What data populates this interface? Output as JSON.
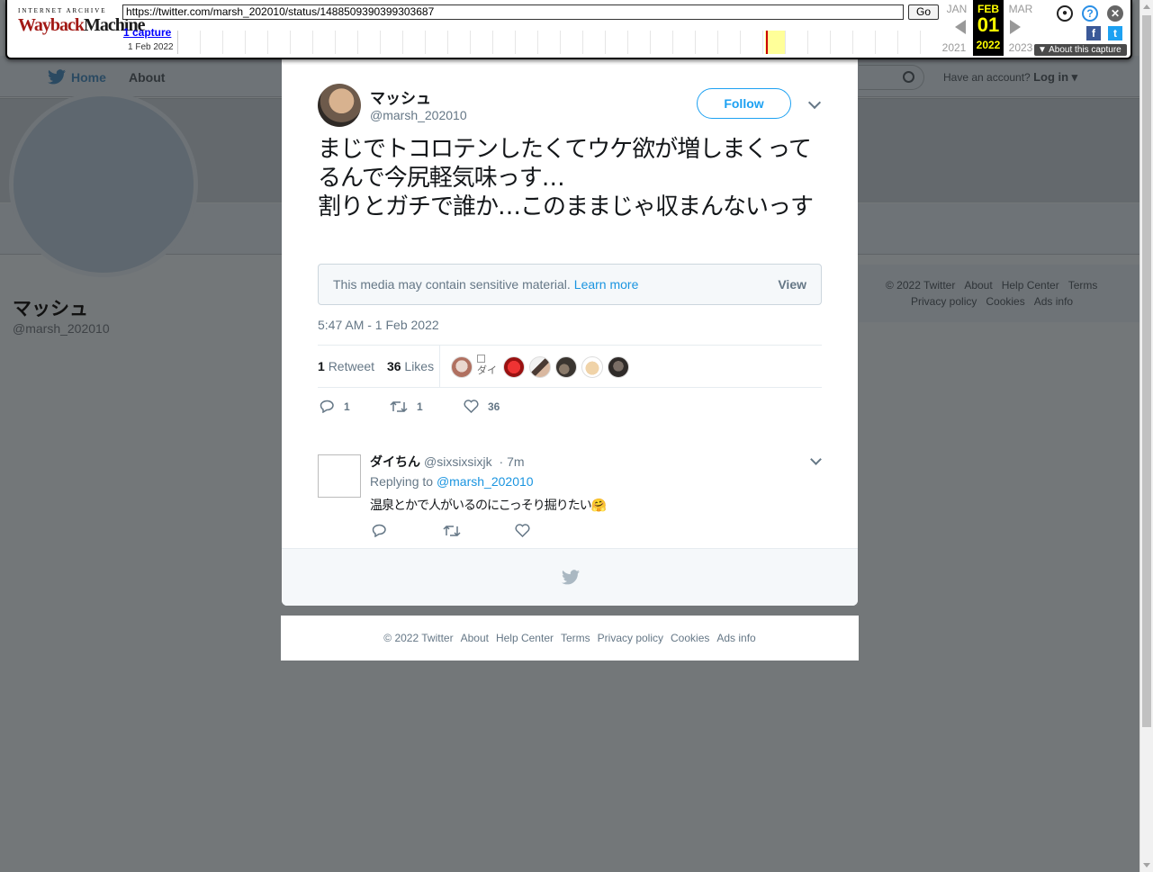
{
  "wayback": {
    "logo_top": "INTERNET ARCHIVE",
    "logo_main_1": "Wayback",
    "logo_main_2": "Machine",
    "url": "https://twitter.com/marsh_202010/status/1488509390399303687",
    "go_label": "Go",
    "captures_label": "1 capture",
    "capture_date": "1 Feb 2022",
    "prev_month": "JAN",
    "prev_year": "2021",
    "cur_month": "FEB",
    "cur_day": "01",
    "cur_year": "2022",
    "next_month": "MAR",
    "next_year": "2023",
    "about_capture": "▼ About this capture"
  },
  "nav": {
    "home_label": "Home",
    "about_label": "About",
    "account_text": "Have an account?",
    "login_label": "Log in ▾"
  },
  "profile": {
    "name": "マッシュ",
    "handle": "@marsh_202010"
  },
  "side_footer": [
    "© 2022 Twitter",
    "About",
    "Help Center",
    "Terms",
    "Privacy policy",
    "Cookies",
    "Ads info"
  ],
  "tweet": {
    "author_name": "マッシュ",
    "author_handle": "@marsh_202010",
    "follow_label": "Follow",
    "text": "まじでトコロテンしたくてウケ欲が増しまくってるんで今尻軽気味っす…\n割りとガチで誰か…このままじゃ収まんないっす",
    "sensitive_text": "This media may contain sensitive material.",
    "learn_more": "Learn more",
    "view_label": "View",
    "timestamp": "5:47 AM - 1 Feb 2022",
    "retweet_count": "1",
    "retweet_label": "Retweet",
    "like_count": "36",
    "like_label": "Likes",
    "broken_avatar_alt": "ダイ",
    "reply_action_count": "1",
    "retweet_action_count": "1",
    "like_action_count": "36"
  },
  "reply": {
    "name": "ダイちん",
    "handle": "@sixsixsixjk",
    "time": "· 7m",
    "replying_to": "Replying to",
    "replying_handle": "@marsh_202010",
    "text": "温泉とかで人がいるのにこっそり掘りたい🤗"
  },
  "footer": [
    "© 2022 Twitter",
    "About",
    "Help Center",
    "Terms",
    "Privacy policy",
    "Cookies",
    "Ads info"
  ],
  "colors": {
    "twitter_blue": "#1da1f2",
    "link_blue": "#1b95e0",
    "overlay_gray": "#737779",
    "wayback_red": "#a21915",
    "wayback_highlight": "#ffff00"
  },
  "icons": {
    "reply": "reply-icon",
    "retweet": "retweet-icon",
    "like": "heart-icon",
    "bird": "twitter-bird-icon",
    "caret": "chevron-down-icon"
  }
}
